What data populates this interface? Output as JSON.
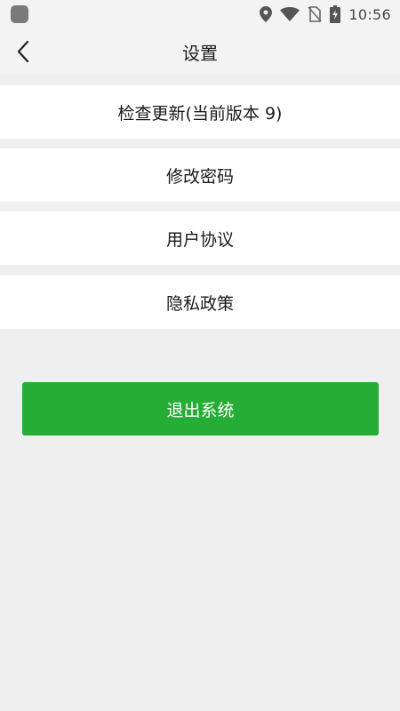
{
  "status_bar": {
    "time": "10:56",
    "icons": [
      "app-notification-icon",
      "location-icon",
      "wifi-icon",
      "no-sim-icon",
      "battery-charging-icon"
    ]
  },
  "header": {
    "title": "设置",
    "back_icon": "chevron-left-icon"
  },
  "menu": {
    "items": [
      {
        "label": "检查更新(当前版本 9)"
      },
      {
        "label": "修改密码"
      },
      {
        "label": "用户协议"
      },
      {
        "label": "隐私政策"
      }
    ]
  },
  "logout": {
    "label": "退出系统"
  },
  "colors": {
    "background": "#efefef",
    "accent_green": "#26ad35",
    "item_background": "#ffffff"
  }
}
